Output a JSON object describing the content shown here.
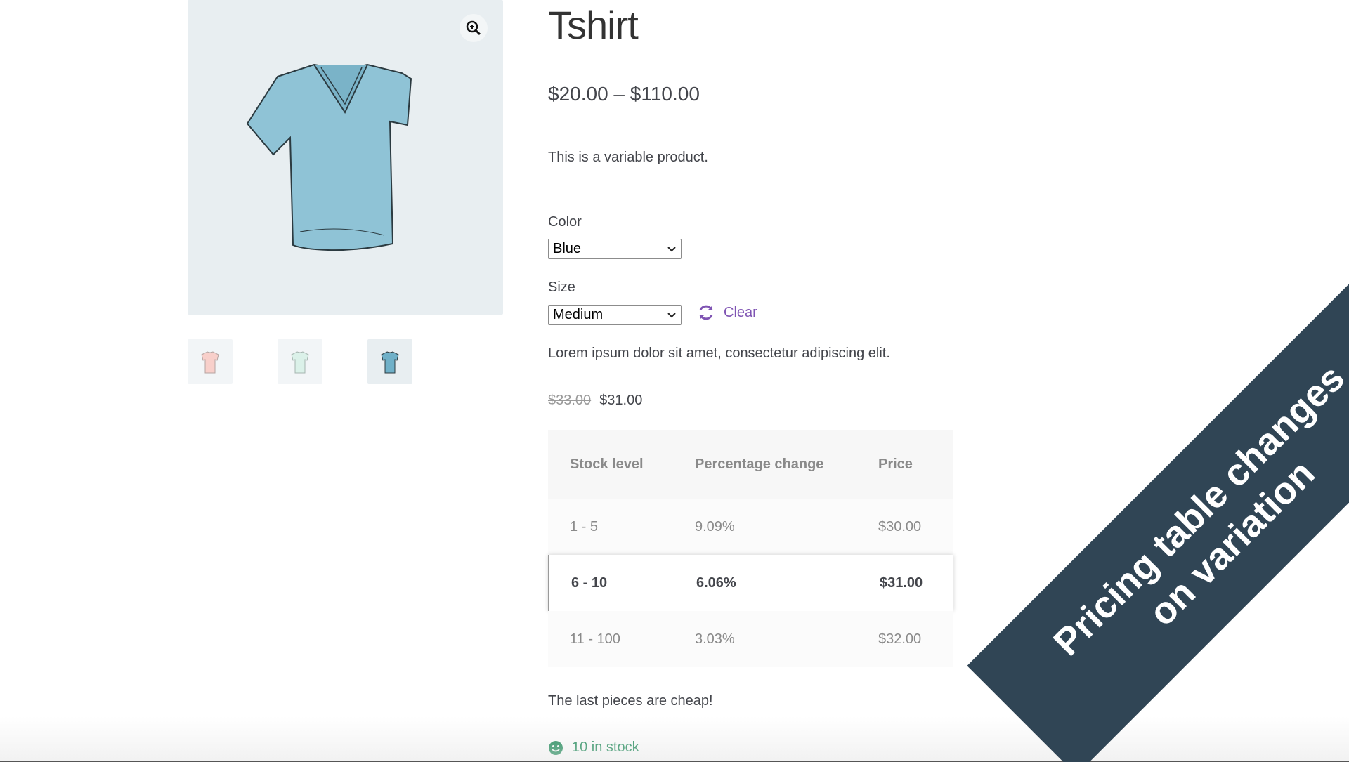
{
  "product": {
    "title": "Tshirt",
    "price_range": "$20.00 – $110.00",
    "short_description": "This is a variable product."
  },
  "gallery": {
    "zoom_icon": "zoom-in-icon",
    "thumbnails": [
      "tshirt-pink-thumb",
      "tshirt-green-thumb",
      "tshirt-blue-thumb"
    ],
    "active_thumbnail": 3
  },
  "variations": {
    "color_label": "Color",
    "color_value": "Blue",
    "size_label": "Size",
    "size_value": "Medium",
    "clear_label": "Clear"
  },
  "variation": {
    "description": "Lorem ipsum dolor sit amet, consectetur adipiscing elit.",
    "old_price": "$33.00",
    "price": "$31.00"
  },
  "pricing_table": {
    "headers": [
      "Stock level",
      "Percentage change",
      "Price"
    ],
    "rows": [
      [
        "1 - 5",
        "9.09%",
        "$30.00"
      ],
      [
        "6 - 10",
        "6.06%",
        "$31.00"
      ],
      [
        "11 - 100",
        "3.03%",
        "$32.00"
      ]
    ],
    "active_row": 2
  },
  "note": "The last pieces are cheap!",
  "stock": "10 in stock",
  "ribbon": {
    "line1": "Pricing table changes",
    "line2": "on variation"
  },
  "colors": {
    "accent": "#7f54b3",
    "stock": "#0f834d",
    "ribbon": "#304555",
    "shirt_blue": "#8fc3d6"
  }
}
